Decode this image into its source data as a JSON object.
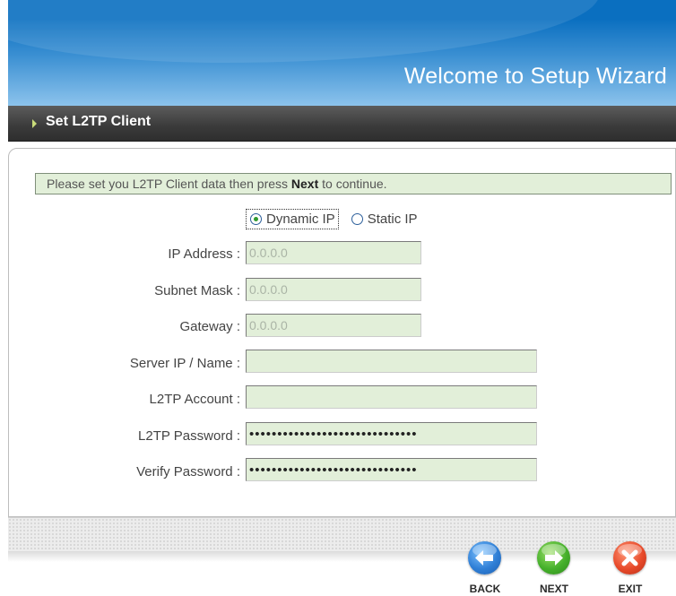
{
  "header": {
    "title": "Welcome to Setup Wizard"
  },
  "section": {
    "title": "Set L2TP Client",
    "arrow_icon": "triangle-right-icon"
  },
  "instruction": {
    "prefix": "Please set you L2TP Client data then press ",
    "emphasis": "Next",
    "suffix": " to continue."
  },
  "ip_mode": {
    "selected": "Dynamic IP",
    "options": [
      "Dynamic IP",
      "Static IP"
    ],
    "dynamic_label": "Dynamic IP",
    "static_label": "Static IP"
  },
  "fields": {
    "ip_address": {
      "label": "IP Address :",
      "value": "0.0.0.0"
    },
    "subnet_mask": {
      "label": "Subnet Mask :",
      "value": "0.0.0.0"
    },
    "gateway": {
      "label": "Gateway :",
      "value": "0.0.0.0"
    },
    "server_ip": {
      "label": "Server IP / Name :",
      "value": ""
    },
    "l2tp_account": {
      "label": "L2TP Account :",
      "value": ""
    },
    "l2tp_password": {
      "label": "L2TP Password :",
      "value": "••••••••••••••••••••••••••••••"
    },
    "verify_password": {
      "label": "Verify Password :",
      "value": "••••••••••••••••••••••••••••••"
    }
  },
  "buttons": {
    "back": {
      "label": "BACK",
      "icon": "arrow-left-icon",
      "color": "#2f7fd6"
    },
    "next": {
      "label": "NEXT",
      "icon": "arrow-right-icon",
      "color": "#45b02b"
    },
    "exit": {
      "label": "EXIT",
      "icon": "close-x-icon",
      "color": "#e84a2a"
    }
  },
  "colors": {
    "banner_blue": "#0a6fc0",
    "section_bar": "#3a3a3a",
    "field_fill": "#e2efd9"
  }
}
